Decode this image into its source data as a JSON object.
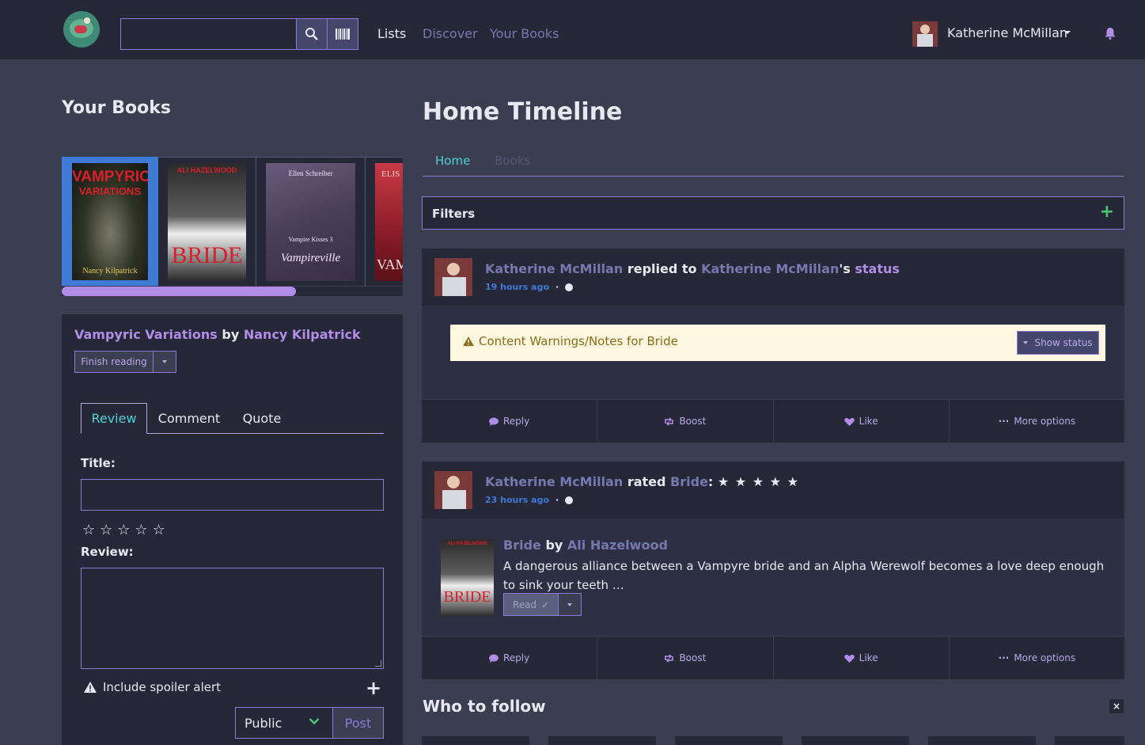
{
  "navbar": {
    "search_placeholder": "",
    "links": [
      "Lists",
      "Discover",
      "Your Books"
    ],
    "user_name": "Katherine McMillan"
  },
  "your_books": {
    "heading": "Your Books",
    "shelf": [
      {
        "title_lines": [
          "VAMPYRIC",
          "VARIATIONS"
        ],
        "author": "Nancy Kilpatrick"
      },
      {
        "top": "ALI HAZELWOOD",
        "title": "BRIDE"
      },
      {
        "top": "Ellen Schreiber",
        "series": "Vampire Kisses 3",
        "title": "Vampireville"
      },
      {
        "top": "ELIS",
        "title": "VAMI"
      }
    ],
    "scroll_fraction": 0.69
  },
  "compose": {
    "book_title": "Vampyric Variations",
    "by": "by",
    "book_author": "Nancy Kilpatrick",
    "finish_label": "Finish reading",
    "tabs": [
      "Review",
      "Comment",
      "Quote"
    ],
    "title_label": "Title:",
    "title_placeholder": "",
    "review_label": "Review:",
    "spoiler_label": "Include spoiler alert",
    "privacy_value": "Public",
    "post_label": "Post"
  },
  "timeline": {
    "heading": "Home Timeline",
    "tabs": [
      "Home",
      "Books"
    ],
    "filters_label": "Filters",
    "posts": [
      {
        "user": "Katherine McMillan",
        "verb": "replied to",
        "target_user": "Katherine McMillan",
        "possessive": "'s",
        "target": "status",
        "time": "19 hours ago",
        "cw_text": "Content Warnings/Notes for Bride",
        "show_status": "Show status"
      },
      {
        "user": "Katherine McMillan",
        "verb": "rated",
        "book": "Bride",
        "colon": ":",
        "stars": "★ ★ ★ ★ ★",
        "rating": 5,
        "time": "23 hours ago",
        "book_title": "Bride",
        "by": "by",
        "book_author": "Ali Hazelwood",
        "description": "A dangerous alliance between a Vampyre bride and an Alpha Werewolf becomes a love deep enough to sink your teeth …",
        "read_label": "Read",
        "cover_top": "ALI HAZELWOOD",
        "cover_title": "BRIDE"
      }
    ],
    "actions": [
      "Reply",
      "Boost",
      "Like",
      "More options"
    ]
  },
  "who_to_follow": {
    "heading": "Who to follow",
    "close": "×"
  },
  "colors": {
    "accent": "#b28de8",
    "link": "#7579b0",
    "nav_bg": "#262838",
    "page_bg": "#3b3d51",
    "green": "#48c774"
  }
}
